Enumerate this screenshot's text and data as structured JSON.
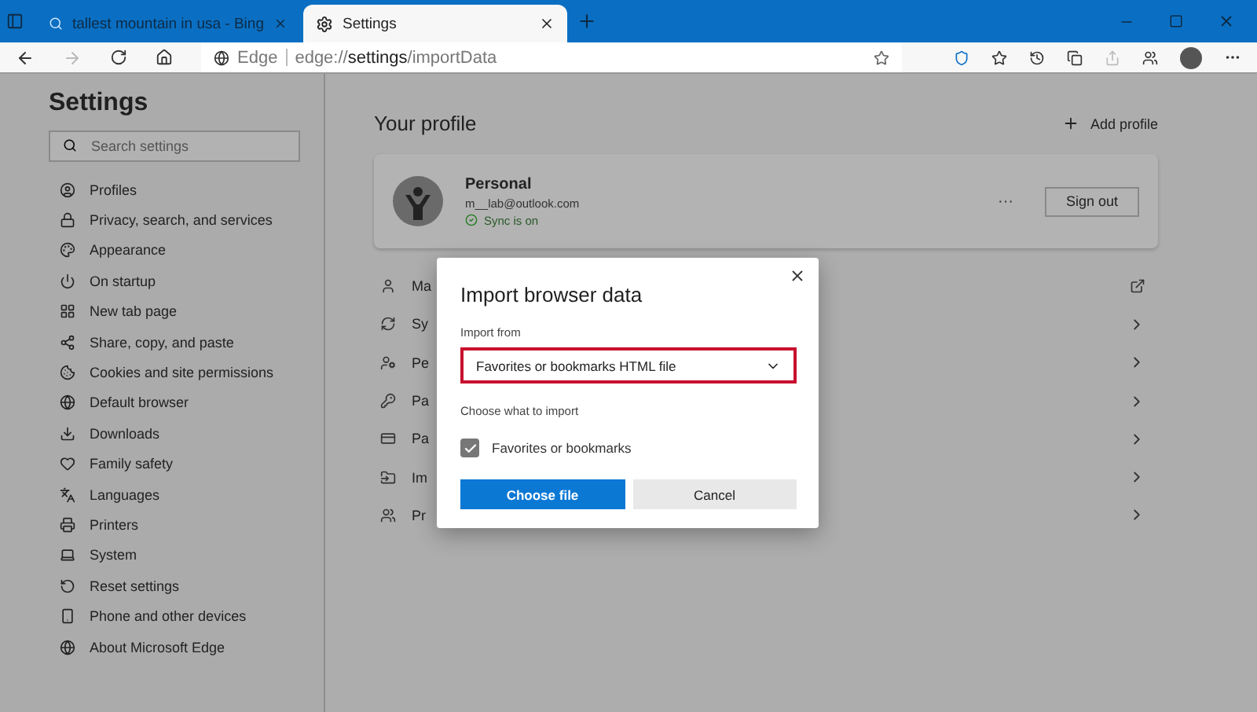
{
  "tabs": [
    {
      "title": "tallest mountain in usa - Bing",
      "selected": false,
      "kind": "search"
    },
    {
      "title": "Settings",
      "selected": true,
      "kind": "settings"
    }
  ],
  "address": {
    "site": "Edge",
    "url_prefix": "edge://",
    "url_host": "settings",
    "url_path": "/importData"
  },
  "sidebar": {
    "title": "Settings",
    "search_placeholder": "Search settings",
    "items": [
      {
        "label": "Profiles"
      },
      {
        "label": "Privacy, search, and services"
      },
      {
        "label": "Appearance"
      },
      {
        "label": "On startup"
      },
      {
        "label": "New tab page"
      },
      {
        "label": "Share, copy, and paste"
      },
      {
        "label": "Cookies and site permissions"
      },
      {
        "label": "Default browser"
      },
      {
        "label": "Downloads"
      },
      {
        "label": "Family safety"
      },
      {
        "label": "Languages"
      },
      {
        "label": "Printers"
      },
      {
        "label": "System"
      },
      {
        "label": "Reset settings"
      },
      {
        "label": "Phone and other devices"
      },
      {
        "label": "About Microsoft Edge"
      }
    ]
  },
  "profile": {
    "heading": "Your profile",
    "add_profile": "Add profile",
    "name": "Personal",
    "email": "m__lab@outlook.com",
    "sync": "Sync is on",
    "more": "···",
    "sign_out": "Sign out",
    "rows": [
      {
        "label": "Ma",
        "kind": "external"
      },
      {
        "label": "Sy",
        "kind": "chevron"
      },
      {
        "label": "Pe",
        "kind": "chevron"
      },
      {
        "label": "Pa",
        "kind": "chevron"
      },
      {
        "label": "Pa",
        "kind": "chevron"
      },
      {
        "label": "Im",
        "kind": "chevron"
      },
      {
        "label": "Pr",
        "kind": "chevron"
      }
    ]
  },
  "dialog": {
    "title": "Import browser data",
    "import_from_label": "Import from",
    "source": "Favorites or bookmarks HTML file",
    "source_highlighted": true,
    "choose_label": "Choose what to import",
    "options": [
      {
        "label": "Favorites or bookmarks",
        "checked": true
      }
    ],
    "primary_button": "Choose file",
    "secondary_button": "Cancel"
  }
}
